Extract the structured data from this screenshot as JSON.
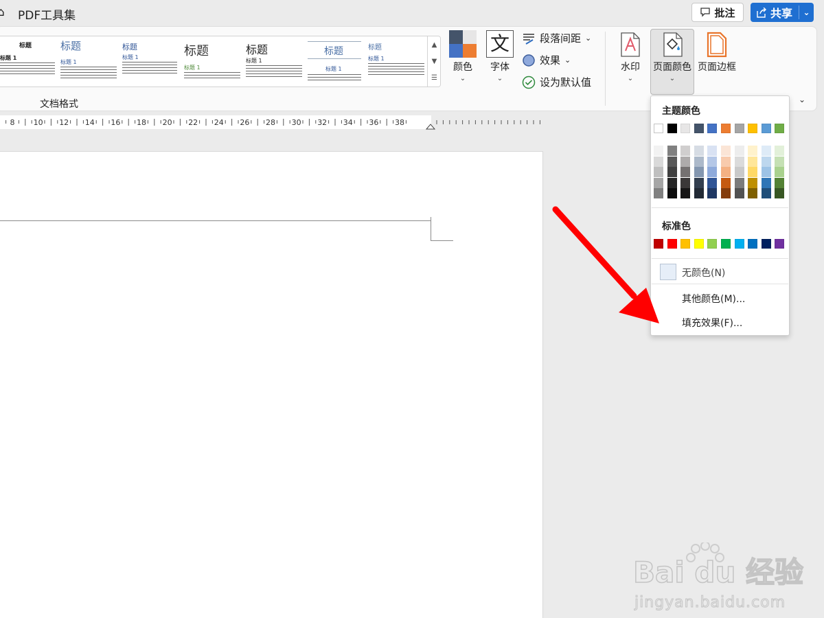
{
  "titlebar": {
    "left_glyph": "⌂",
    "app_title": "PDF工具集",
    "comment_label": "批注",
    "share_label": "共享",
    "share_chevron": "⌄"
  },
  "ribbon": {
    "group_label": "文档格式",
    "styles": [
      {
        "title": "标题",
        "h1": "标题 1"
      },
      {
        "title": "标题",
        "h1": "标题 1"
      },
      {
        "title": "标题",
        "h1": "标题 1"
      },
      {
        "title": "标题",
        "h1": "标题 1"
      },
      {
        "title": "标题",
        "h1": "标题 1"
      },
      {
        "title": "标题",
        "h1": "标题 1"
      },
      {
        "title": "标题",
        "h1": "标题 1"
      }
    ],
    "colors_label": "颜色",
    "fonts_label": "字体",
    "fonts_glyph": "文",
    "paragraph_spacing_label": "段落间距",
    "effects_label": "效果",
    "set_default_label": "设为默认值",
    "watermark_label": "水印",
    "page_color_label": "页面颜色",
    "page_borders_label": "页面边框",
    "caret": "⌄",
    "colors_scheme": [
      "#44546a",
      "#e7e6e6",
      "#4472c4",
      "#ed7d31"
    ]
  },
  "ruler": {
    "labels": [
      "8",
      "10",
      "12",
      "14",
      "16",
      "18",
      "20",
      "22",
      "24",
      "26",
      "28",
      "30",
      "32",
      "34",
      "36",
      "38"
    ]
  },
  "page_color_menu": {
    "theme_colors_header": "主题颜色",
    "theme_colors": [
      "#ffffff",
      "#000000",
      "#e7e6e6",
      "#44546a",
      "#4472c4",
      "#ed7d31",
      "#a5a5a5",
      "#ffc000",
      "#5b9bd5",
      "#70ad47"
    ],
    "theme_shades": [
      [
        "#f2f2f2",
        "#d9d9d9",
        "#bfbfbf",
        "#a6a6a6",
        "#808080"
      ],
      [
        "#808080",
        "#595959",
        "#404040",
        "#262626",
        "#0d0d0d"
      ],
      [
        "#d0cece",
        "#aeabab",
        "#757171",
        "#3b3838",
        "#171616"
      ],
      [
        "#d6dce4",
        "#acb9ca",
        "#8497b0",
        "#333f4f",
        "#222a35"
      ],
      [
        "#d9e2f3",
        "#b4c7e7",
        "#8eaadb",
        "#2f5496",
        "#1f3864"
      ],
      [
        "#fbe5d6",
        "#f8cbad",
        "#f4b183",
        "#c55a11",
        "#843c0c"
      ],
      [
        "#ededed",
        "#dbdbdb",
        "#c9c9c9",
        "#7b7b7b",
        "#525252"
      ],
      [
        "#fff2cc",
        "#ffe699",
        "#ffd966",
        "#bf9000",
        "#7f6000"
      ],
      [
        "#deebf7",
        "#bdd7ee",
        "#9dc3e6",
        "#2e75b6",
        "#1f4e79"
      ],
      [
        "#e2f0d9",
        "#c5e0b4",
        "#a9d18e",
        "#548235",
        "#385723"
      ]
    ],
    "standard_colors_header": "标准色",
    "standard_colors": [
      "#c00000",
      "#ff0000",
      "#ffc000",
      "#ffff00",
      "#92d050",
      "#00b050",
      "#00b0f0",
      "#0070c0",
      "#002060",
      "#7030a0"
    ],
    "no_color_label": "无颜色(N)",
    "more_colors_label": "其他颜色(M)...",
    "fill_effects_label": "填充效果(F)..."
  },
  "annotation": {
    "arrow_color": "#ff0000"
  },
  "watermark": {
    "brand": "Bai du 经验",
    "site": "jingyan.baidu.com"
  }
}
